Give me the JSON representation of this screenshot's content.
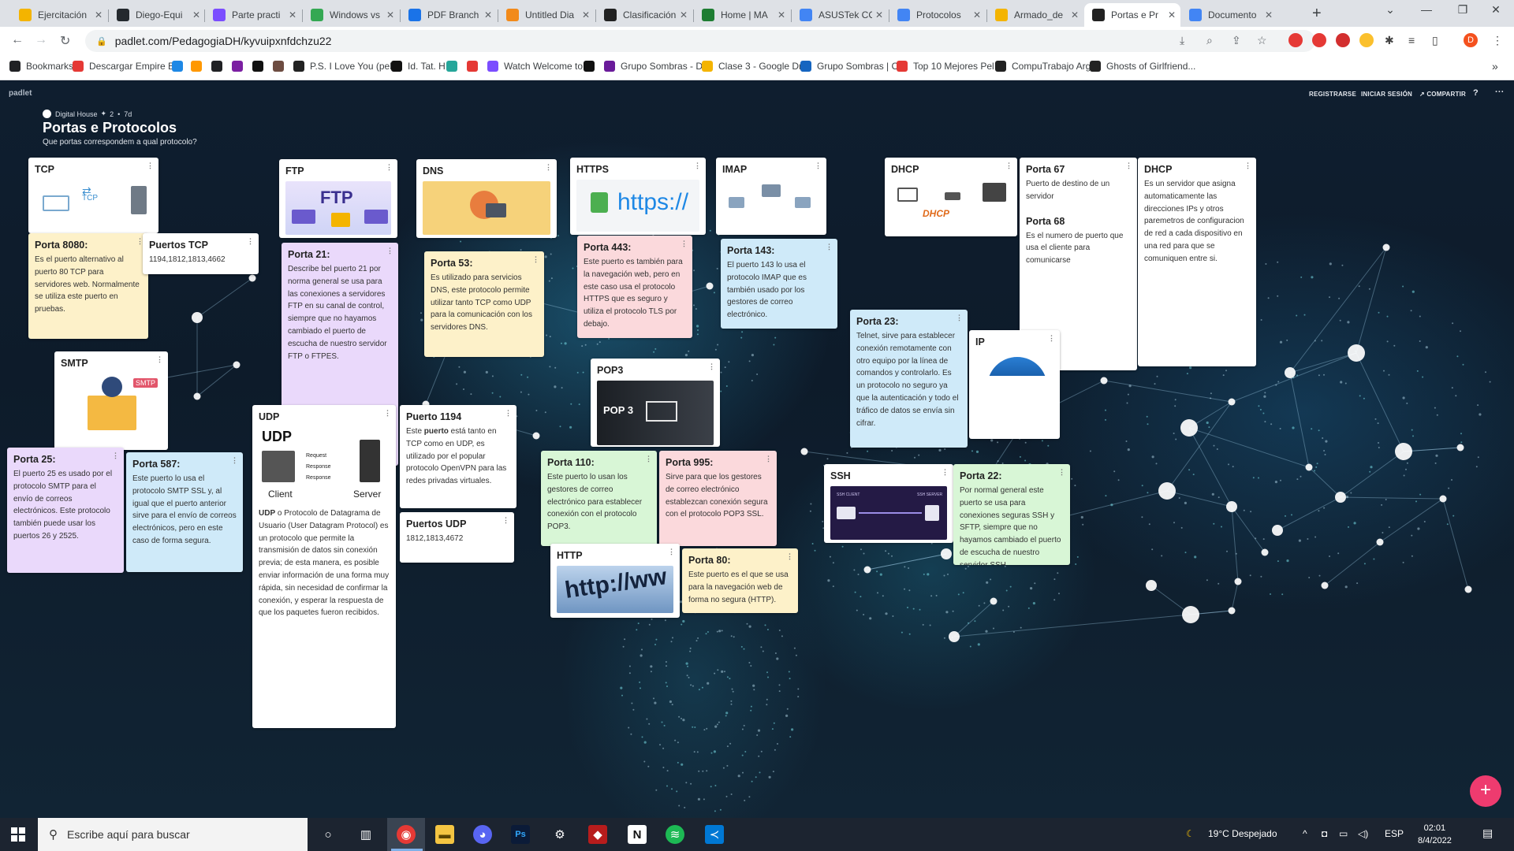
{
  "browser": {
    "tabs": [
      {
        "label": "Ejercitación",
        "color": "#f4b400"
      },
      {
        "label": "Diego-Equi",
        "color": "#24292e"
      },
      {
        "label": "Parte practi",
        "color": "#7b4dff"
      },
      {
        "label": "Windows vs",
        "color": "#34a853"
      },
      {
        "label": "PDF Branch",
        "color": "#1a73e8"
      },
      {
        "label": "Untitled Dia",
        "color": "#f28a1a"
      },
      {
        "label": "Clasificación",
        "color": "#222222"
      },
      {
        "label": "Home | MA",
        "color": "#1e7d32"
      },
      {
        "label": "ASUSTek CC",
        "color": "#4285f4"
      },
      {
        "label": "Protocolos",
        "color": "#4285f4"
      },
      {
        "label": "Armado_de",
        "color": "#f4b400"
      },
      {
        "label": "Portas e Pr",
        "color": "#222222"
      },
      {
        "label": "Documento",
        "color": "#4285f4"
      }
    ],
    "active_tab_index": 11,
    "url": "padlet.com/PedagogiaDH/kyvuipxnfdchzu22",
    "bookmarks": [
      {
        "label": "Bookmarks",
        "color": "#202124"
      },
      {
        "label": "Descargar Empire E...",
        "color": "#e53935"
      },
      {
        "label": "",
        "color": "#1e88e5"
      },
      {
        "label": "",
        "color": "#ff9800"
      },
      {
        "label": "",
        "color": "#202124"
      },
      {
        "label": "",
        "color": "#7b1fa2"
      },
      {
        "label": "",
        "color": "#111111"
      },
      {
        "label": "",
        "color": "#6d4c41"
      },
      {
        "label": "P.S. I Love You (pelí...",
        "color": "#222222"
      },
      {
        "label": "Id. Tat. H",
        "color": "#111111"
      },
      {
        "label": "",
        "color": "#26a69a"
      },
      {
        "label": "",
        "color": "#e53935"
      },
      {
        "label": "Watch Welcome to...",
        "color": "#7b4dff"
      },
      {
        "label": "",
        "color": "#111111"
      },
      {
        "label": "Grupo Sombras - D...",
        "color": "#6a1b9a"
      },
      {
        "label": "Clase 3 - Google Dr...",
        "color": "#f4b400"
      },
      {
        "label": "Grupo Sombras | C...",
        "color": "#1565c0"
      },
      {
        "label": "Top 10 Mejores Pelí...",
        "color": "#e53935"
      },
      {
        "label": "CompuTrabajo Arg...",
        "color": "#222222"
      },
      {
        "label": "Ghosts of Girlfriend...",
        "color": "#222222"
      }
    ]
  },
  "padlet": {
    "brand": "padlet",
    "actions": [
      "REGISTRARSE",
      "INICIAR SESIÓN",
      "COMPARTIR"
    ],
    "author": "Digital House",
    "likes": "2",
    "age": "7d",
    "title": "Portas e Protocolos",
    "subtitle": "Que portas correspondem a qual protocolo?",
    "cards": {
      "tcp": {
        "title": "TCP",
        "img": "TCP"
      },
      "porta8080": {
        "title": "Porta 8080:",
        "body": "Es el puerto alternativo al puerto 80 TCP para servidores web. Normalmente se utiliza este puerto en pruebas."
      },
      "puertos_tcp": {
        "title": "Puertos TCP",
        "body": "1194,1812,1813,4662"
      },
      "ftp": {
        "title": "FTP",
        "img": "FTP"
      },
      "porta21": {
        "title": "Porta 21:",
        "body": "Describe bel puerto 21 por norma general se usa para las conexiones a servidores FTP en su canal de control, siempre que no hayamos cambiado el puerto de escucha de nuestro servidor FTP o FTPES."
      },
      "dns": {
        "title": "DNS"
      },
      "porta53": {
        "title": "Porta 53:",
        "body": "Es utilizado para servicios DNS, este protocolo permite utilizar tanto TCP como UDP para la comunicación con los servidores DNS."
      },
      "https": {
        "title": "HTTPS",
        "img": "https://"
      },
      "porta443": {
        "title": "Porta 443:",
        "body": "Este puerto es también para la navegación web, pero en este caso usa el protocolo HTTPS que es seguro y utiliza el protocolo TLS por debajo."
      },
      "imap": {
        "title": "IMAP"
      },
      "porta143": {
        "title": "Porta 143:",
        "body": "El puerto 143 lo usa el protocolo IMAP que es también usado por los gestores de correo electrónico."
      },
      "dhcp_img": {
        "title": "DHCP",
        "img": "DHCP"
      },
      "porta67": {
        "title": "Porta 67",
        "body": "Puerto de destino de un servidor"
      },
      "porta68": {
        "title": "Porta 68",
        "body": "Es el numero de puerto que usa el cliente para comunicarse"
      },
      "dhcp_text": {
        "title": "DHCP",
        "body": "Es un servidor que asigna automaticamente las direcciones IPs y otros paremetros de configuracion de red a cada dispositivo en una red para que se comuniquen entre si."
      },
      "smtp": {
        "title": "SMTP",
        "img": "SMTP"
      },
      "porta25": {
        "title": "Porta 25:",
        "body": "El puerto 25 es usado por el protocolo SMTP para el envío de correos electrónicos. Este protocolo también puede usar los puertos 26 y 2525."
      },
      "porta587": {
        "title": "Porta 587:",
        "body": "Este puerto lo usa el protocolo SMTP SSL y, al igual que el puerto anterior sirve para el envío de correos electrónicos, pero en este caso de forma segura."
      },
      "udp": {
        "title": "UDP",
        "img": "UDP",
        "client": "Client",
        "server": "Server",
        "req": "Request",
        "resp": "Response",
        "body_bold": "UDP",
        "body": " o Protocolo de Datagrama de Usuario (User Datagram Protocol) es un protocolo que permite la transmisión de datos sin conexión previa; de esta manera, es posible enviar información de una forma muy rápida, sin necesidad de confirmar la conexión, y esperar la respuesta de que los paquetes fueron recibidos."
      },
      "puerto1194": {
        "title": "Puerto 1194",
        "body_a": "Este ",
        "body_bold": "puerto",
        "body_b": " está tanto en TCP como en UDP, es utilizado por el popular protocolo OpenVPN para las redes privadas virtuales."
      },
      "puertos_udp": {
        "title": "Puertos UDP",
        "body": "1812,1813,4672"
      },
      "pop3": {
        "title": "POP3",
        "img": "POP 3"
      },
      "porta110": {
        "title": "Porta 110:",
        "body": "Este puerto lo usan los gestores de correo electrónico para establecer conexión con el protocolo POP3."
      },
      "porta995": {
        "title": "Porta 995:",
        "body": "Sirve para que los gestores de correo electrónico establezcan conexión segura con el protocolo POP3 SSL."
      },
      "porta23": {
        "title": "Porta 23:",
        "body": "Telnet, sirve para establecer conexión remotamente con otro equipo por la línea de comandos y controlarlo. Es un protocolo no seguro ya que la autenticación y todo el tráfico de datos se envía sin cifrar."
      },
      "ip": {
        "title": "IP"
      },
      "http": {
        "title": "HTTP",
        "img": "http://ww"
      },
      "porta80": {
        "title": "Porta 80:",
        "body": "Este puerto es el que se usa para la navegación web de forma no segura (HTTP)."
      },
      "ssh": {
        "title": "SSH",
        "img_left": "SSH CLIENT",
        "img_right": "SSH SERVER"
      },
      "porta22": {
        "title": "Porta 22:",
        "body": "Por normal general este puerto se usa para conexiones seguras SSH y SFTP, siempre que no hayamos cambiado el puerto de escucha de nuestro servidor SSH."
      }
    }
  },
  "taskbar": {
    "search_placeholder": "Escribe aquí para buscar",
    "weather": "19°C  Despejado",
    "lang": "ESP",
    "time": "02:01",
    "date": "8/4/2022"
  }
}
